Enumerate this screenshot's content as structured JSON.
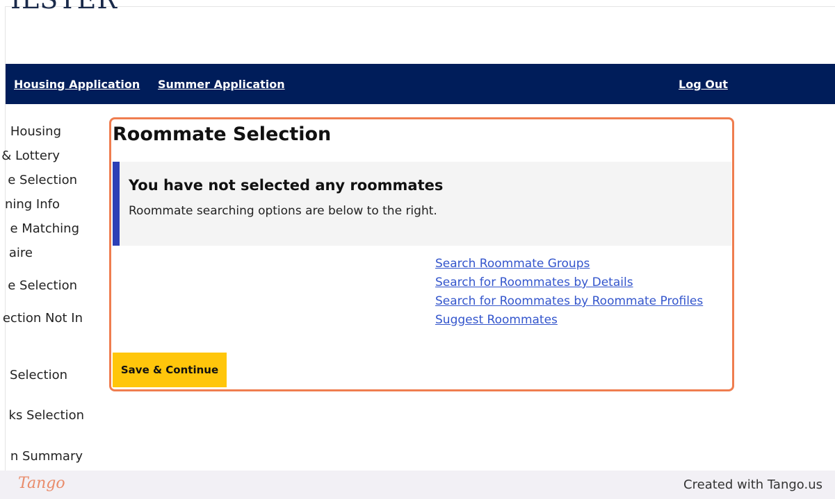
{
  "header": {
    "logo_text": "ILSTER"
  },
  "nav": {
    "housing_application": "Housing Application",
    "summer_application": "Summer Application",
    "log_out": "Log Out"
  },
  "sidebar": {
    "items": [
      {
        "label": "Housing"
      },
      {
        "label": "& Lottery"
      },
      {
        "label": "e Selection"
      },
      {
        "label": "ning Info"
      },
      {
        "label": "e Matching"
      },
      {
        "label": "aire"
      },
      {
        "label": "e Selection"
      },
      {
        "label": "ection Not In"
      },
      {
        "label": "Selection"
      },
      {
        "label": "ks Selection"
      },
      {
        "label": "n Summary"
      }
    ]
  },
  "main": {
    "title": "Roommate Selection",
    "notice": {
      "title": "You have not selected any roommates",
      "text": "Roommate searching options are below to the right."
    },
    "links": [
      {
        "label": "Search Roommate Groups"
      },
      {
        "label": "Search for Roommates by Details"
      },
      {
        "label": "Search for Roommates by Roommate Profiles"
      },
      {
        "label": "Suggest Roommates"
      }
    ],
    "save_button": "Save & Continue"
  },
  "footer": {
    "logo": "Tango",
    "created_with": "Created with Tango.us"
  },
  "colors": {
    "nav_background": "#001d5a",
    "highlight_border": "#ef7d4f",
    "notice_accent": "#2d3fb6",
    "button_background": "#ffc60b",
    "link_color": "#3355cc"
  }
}
